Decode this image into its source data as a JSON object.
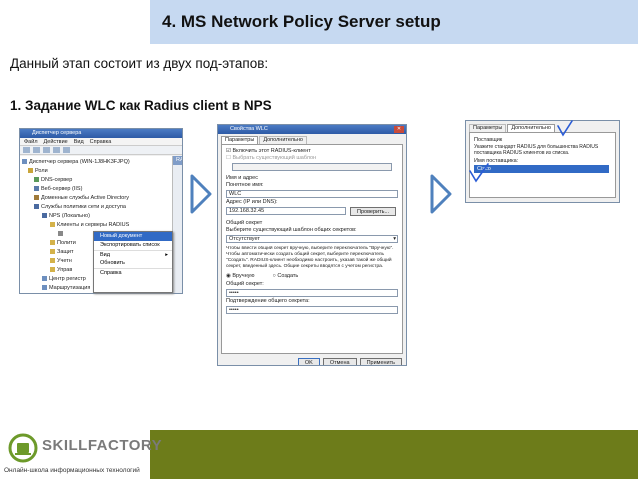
{
  "slide": {
    "title": "4.   MS Network Policy Server setup",
    "intro": "Данный этап состоит из двух под-этапов:",
    "step": "1.  Задание WLC как Radius client в NPS"
  },
  "server_manager": {
    "window_title": "Диспетчер сервера",
    "menu": [
      "Файл",
      "Действие",
      "Вид",
      "Справка"
    ],
    "tree": [
      "Диспетчер сервера (WIN-1J8HK3FJPQ)",
      "Роли",
      "DNS-сервер",
      "Веб-сервер (IIS)",
      "Доменные службы Active Directory",
      "Службы политики сети и доступа",
      "NPS (Локально)",
      "Клиенты и серверы RADIUS",
      "Полити",
      "Защит",
      "Учетн",
      "Управ",
      "Центр регистр",
      "Маршрутизация"
    ],
    "right_label": "RADIU",
    "context_menu": [
      "Новый документ",
      "Экспортировать список",
      "Вид",
      "Обновить",
      "Справка"
    ]
  },
  "wlc_dialog": {
    "window_title": "Свойства WLC",
    "tabs": [
      "Параметры",
      "Дополнительно"
    ],
    "enable_checkbox": "Включить этот RADIUS-клиент",
    "select_template_checkbox": "Выбрать существующий шаблон",
    "name_label": "Имя и адрес",
    "friendly_name_label": "Понятное имя:",
    "friendly_name_value": "WLC",
    "address_label": "Адрес (IP или DNS):",
    "address_value": "192.168.32.45",
    "verify_button": "Проверить...",
    "shared_secret_group": "Общий секрет",
    "template_label": "Выберите существующий шаблон общих секретов:",
    "template_value": "Отсутствует",
    "hint_text": "Чтобы ввести общий секрет вручную, выберите переключатель \"Вручную\". Чтобы автоматически создать общий секрет, выберите переключатель \"Создать\". RADIUS-клиент необходимо настроить, указав такой же общий секрет, введенный здесь. Общие секреты вводятся с учетом регистра.",
    "manual_radio": "Вручную",
    "generate_radio": "Создать",
    "secret_label": "Общий секрет:",
    "secret_value": "•••••",
    "confirm_label": "Подтверждение общего секрета:",
    "confirm_value": "•••••",
    "ok_button": "OK",
    "cancel_button": "Отмена",
    "apply_button": "Применить"
  },
  "advanced_tab": {
    "tabs": [
      "Параметры",
      "Дополнительно"
    ],
    "vendor_label": "Поставщик",
    "vendor_hint": "Укажите стандарт RADIUS для большинства RADIUS поставщика RADIUS клиентов из списка.",
    "vendor_name_label": "Имя поставщика:",
    "vendor_value": "Cisco"
  },
  "footer": {
    "logo_text": "SKILLFACTORY",
    "logo_sub": "Онлайн-школа информационных технологий"
  },
  "colors": {
    "title_bg": "#c6d9f1",
    "arrow": "#4f81bd",
    "footer_bar": "#6d7c1a",
    "checkmark": "#2a5cd6"
  }
}
